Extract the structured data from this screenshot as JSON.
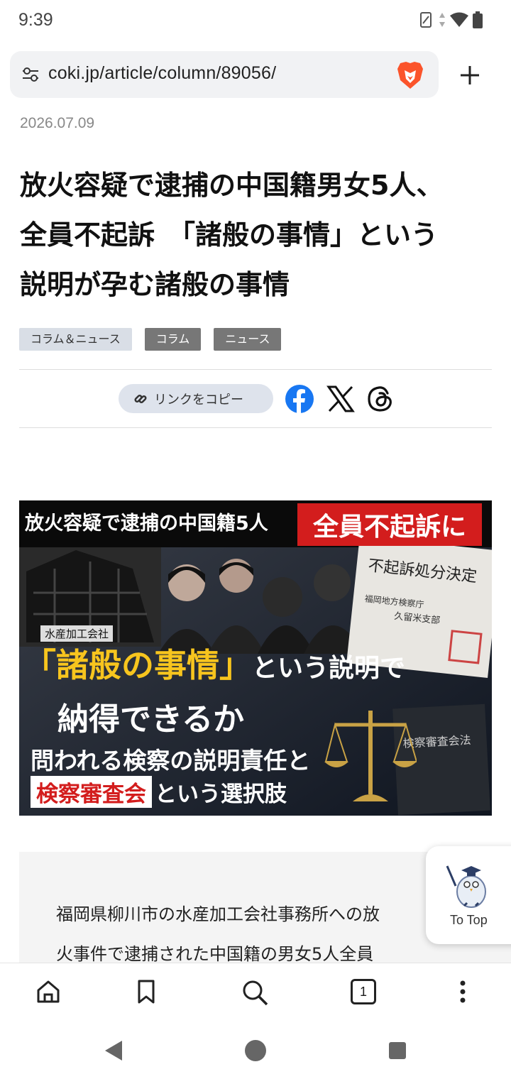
{
  "status_bar": {
    "time": "9:39"
  },
  "browser": {
    "url": "coki.jp/article/column/89056/",
    "tab_count": "1"
  },
  "article": {
    "date": "2026.07.09",
    "title_lines": [
      "放火容疑で逮捕の中国籍男女5人、",
      "全員不起訴　「諸般の事情」という",
      "説明が孕む諸般の事情"
    ],
    "tags": [
      "コラム＆ニュース",
      "コラム",
      "ニュース"
    ],
    "copy_link_label": "リンクをコピー",
    "body_lines": [
      "福岡県柳川市の水産加工会社事務所への放",
      "火事件で逮捕された中国籍の男女5人全員"
    ]
  },
  "hero_image": {
    "headline": "放火容疑で逮捕の中国籍5人",
    "red_box": "全員不起訴に",
    "doc_title": "不起訴処分決定",
    "doc_sub1": "福岡地方検察庁",
    "doc_sub2": "久留米支部",
    "small_label": "水産加工会社",
    "big_yellow": "「諸般の事情」",
    "big_white": "という説明で",
    "line2": "納得できるか",
    "line3": "問われる検察の説明責任と",
    "line4_highlight": "検察審査会",
    "line4_rest": "という選択肢",
    "book_label": "検察審査会法"
  },
  "to_top": {
    "label": "To Top"
  },
  "colors": {
    "accent_red": "#d31d1d",
    "accent_yellow": "#f7c51e",
    "facebook_blue": "#1877f2",
    "brave_orange": "#fb542b"
  },
  "icons": {
    "url_settings": "tune-icon",
    "brave": "brave-lion-icon",
    "new_tab": "plus-icon",
    "copy_link": "link-icon",
    "share": [
      "facebook-icon",
      "x-icon",
      "threads-icon"
    ],
    "toolbar": [
      "home-icon",
      "bookmark-icon",
      "search-icon",
      "tabs-icon",
      "more-vert-icon"
    ],
    "nav": [
      "back-icon",
      "home-circle-icon",
      "recents-icon"
    ]
  }
}
